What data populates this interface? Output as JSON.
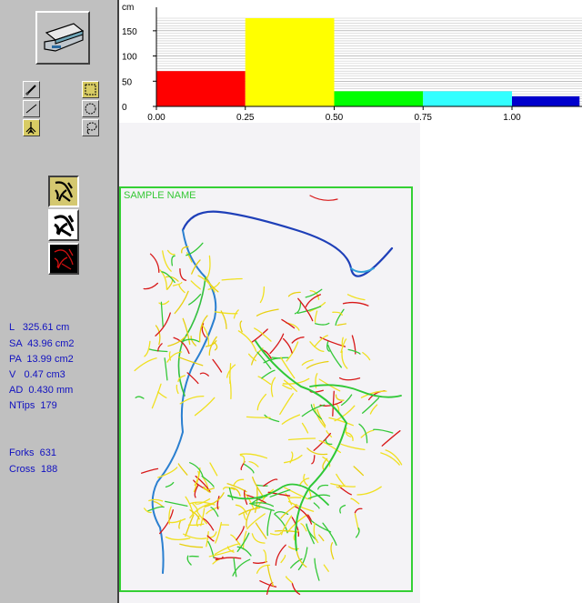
{
  "toolbar": {
    "scanner_icon": "scanner-icon",
    "tools": [
      "pencil-icon",
      "line-icon",
      "tree-icon",
      "rect-select-icon",
      "circle-select-icon",
      "lasso-icon"
    ],
    "views": [
      "skeleton-view-icon",
      "outline-view-icon",
      "red-overlay-icon"
    ]
  },
  "stats": {
    "L": "L   325.61 cm",
    "SA": "SA  43.96 cm2",
    "PA": "PA  13.99 cm2",
    "V": "V   0.47 cm3",
    "AD": "AD  0.430 mm",
    "NTips": "NTips  179",
    "Forks": "Forks  631",
    "Cross": "Cross  188"
  },
  "sample": {
    "name": "SAMPLE NAME"
  },
  "chart_data": {
    "type": "bar",
    "ylabel": "cm",
    "ylim": [
      0,
      175
    ],
    "yticks": [
      "0",
      "50",
      "100",
      "150"
    ],
    "xticks": [
      "0.00",
      "0.25",
      "0.50",
      "0.75",
      "1.00"
    ],
    "bins": [
      {
        "from": 0.0,
        "to": 0.25,
        "value": 70,
        "color": "#ff0000"
      },
      {
        "from": 0.25,
        "to": 0.5,
        "value": 175,
        "color": "#ffff00"
      },
      {
        "from": 0.5,
        "to": 0.75,
        "value": 30,
        "color": "#00ff00"
      },
      {
        "from": 0.75,
        "to": 1.0,
        "value": 30,
        "color": "#33ffff"
      },
      {
        "from": 1.0,
        "to": 1.19,
        "value": 20,
        "color": "#0000cc"
      }
    ],
    "grid": true
  }
}
